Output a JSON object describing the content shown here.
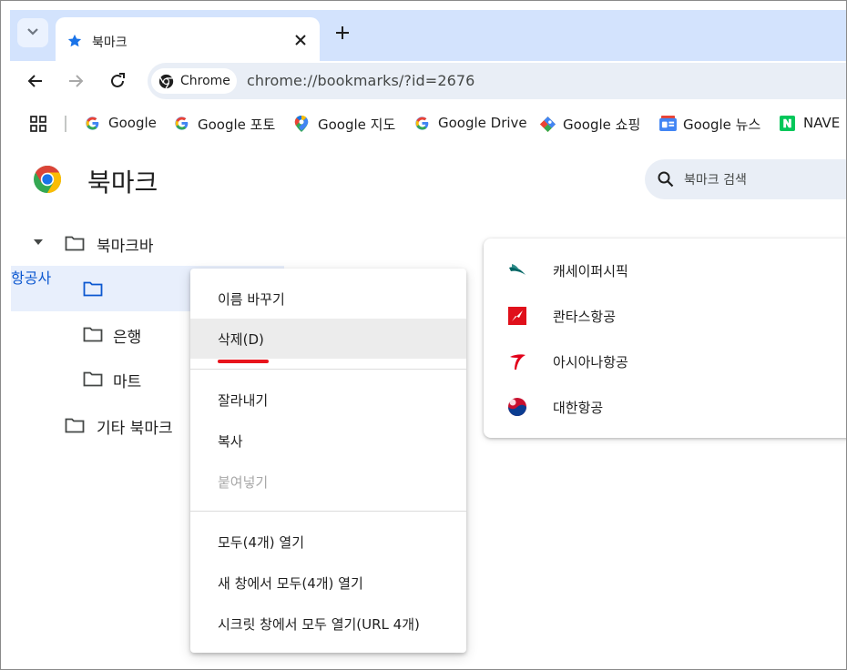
{
  "tab": {
    "title": "북마크"
  },
  "omnibox": {
    "chip_label": "Chrome",
    "url": "chrome://bookmarks/?id=2676"
  },
  "bookmarks_bar": [
    {
      "label": "Google",
      "icon": "google-g-icon"
    },
    {
      "label": "Google 포토",
      "icon": "google-g-icon"
    },
    {
      "label": "Google 지도",
      "icon": "google-maps-icon"
    },
    {
      "label": "Google Drive",
      "icon": "google-g-icon"
    },
    {
      "label": "Google 쇼핑",
      "icon": "google-shopping-icon"
    },
    {
      "label": "Google 뉴스",
      "icon": "google-news-icon"
    },
    {
      "label": "NAVE",
      "icon": "naver-icon"
    }
  ],
  "page": {
    "title": "북마크",
    "search_placeholder": "북마크 검색"
  },
  "tree": {
    "root": "북마크바",
    "folders": [
      "항공사",
      "은행",
      "마트"
    ],
    "other": "기타 북마크"
  },
  "list": [
    {
      "label": "캐세이퍼시픽",
      "icon": "cathay-pacific-icon"
    },
    {
      "label": "콴타스항공",
      "icon": "qantas-icon"
    },
    {
      "label": "아시아나항공",
      "icon": "asiana-icon"
    },
    {
      "label": "대한항공",
      "icon": "korean-air-icon"
    }
  ],
  "context_menu": {
    "rename": "이름 바꾸기",
    "delete": "삭제(D)",
    "cut": "잘라내기",
    "copy": "복사",
    "paste": "붙여넣기",
    "open_all": "모두(4개) 열기",
    "open_all_new_window": "새 창에서 모두(4개) 열기",
    "open_all_incognito": "시크릿 창에서 모두 열기(URL 4개)"
  },
  "colors": {
    "accent_blue": "#0b57d0",
    "tab_strip": "#d3e3fd",
    "selection": "#e8effc",
    "underline_red": "#e8141c"
  }
}
